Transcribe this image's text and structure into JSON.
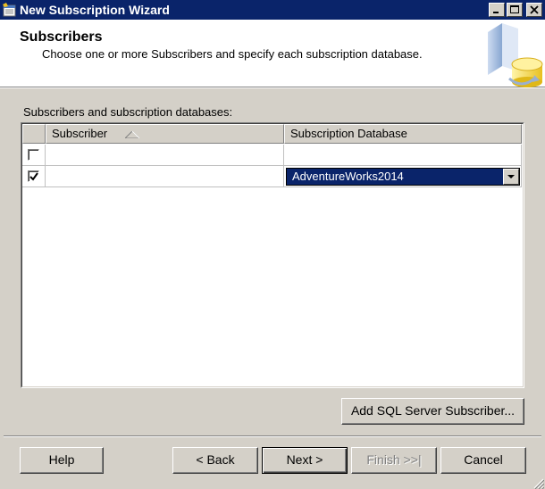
{
  "window": {
    "title": "New Subscription Wizard",
    "controls": [
      "minimize",
      "maximize",
      "close"
    ]
  },
  "header": {
    "title": "Subscribers",
    "subtitle": "Choose one or more Subscribers and specify each subscription database."
  },
  "grid": {
    "label": "Subscribers and subscription databases:",
    "columns": [
      "Subscriber",
      "Subscription Database"
    ],
    "sorted_column": "Subscriber",
    "rows": [
      {
        "checked": false,
        "subscriber": "",
        "database": ""
      },
      {
        "checked": true,
        "subscriber": "",
        "database": "AdventureWorks2014"
      }
    ]
  },
  "buttons": {
    "add_subscriber": "Add SQL Server Subscriber...",
    "help": "Help",
    "back": "< Back",
    "next": "Next >",
    "finish": "Finish >>|",
    "cancel": "Cancel"
  },
  "colors": {
    "titlebar": "#0a246a",
    "selection": "#0a246a",
    "dialog_face": "#d4d0c8"
  }
}
